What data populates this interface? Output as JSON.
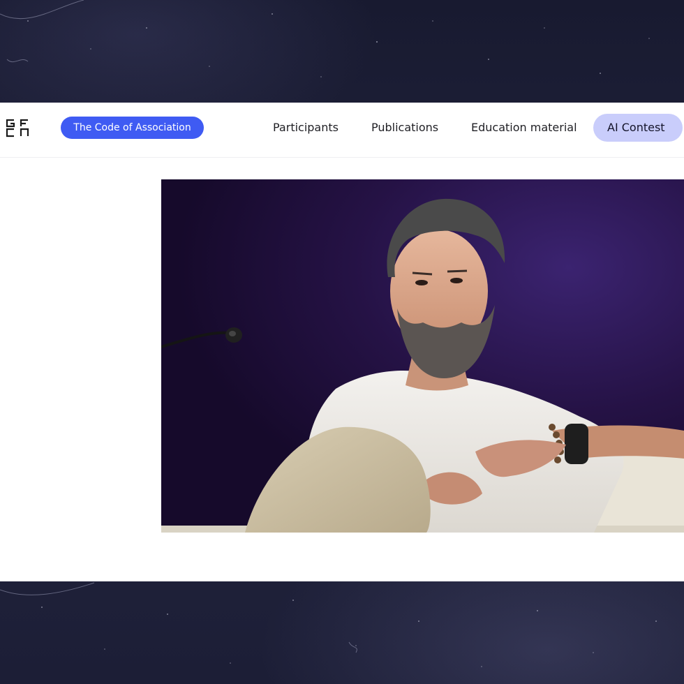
{
  "header": {
    "logo_name": "gfcn-logo",
    "pill_button_label": "The Code of Association",
    "nav": {
      "participants": "Participants",
      "publications": "Publications",
      "education": "Education material",
      "contest": "AI Contest"
    }
  },
  "colors": {
    "accent": "#3f5bf3",
    "active_pill": "#c9cdfb",
    "background": "#1b1c33"
  }
}
